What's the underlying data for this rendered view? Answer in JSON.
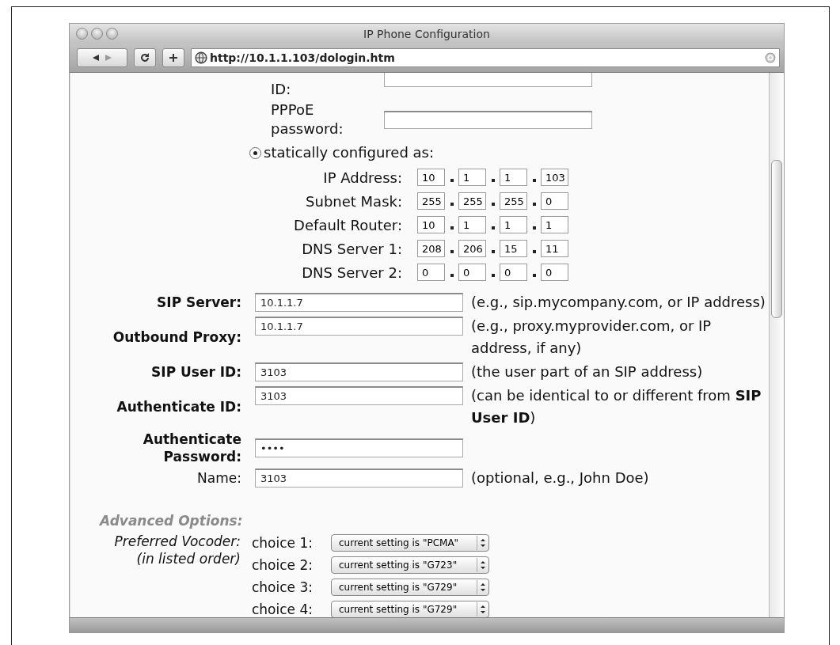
{
  "window": {
    "title": "IP Phone Configuration"
  },
  "toolbar": {
    "url": "http://10.1.1.103/dologin.htm"
  },
  "pppoe_fields": [
    {
      "label": "ID:"
    },
    {
      "label": "PPPoE password:"
    }
  ],
  "static_option": {
    "label": "statically configured as:",
    "selected": true
  },
  "network": [
    {
      "label": "IP Address:",
      "octets": [
        "10",
        "1",
        "1",
        "103"
      ]
    },
    {
      "label": "Subnet Mask:",
      "octets": [
        "255",
        "255",
        "255",
        "0"
      ]
    },
    {
      "label": "Default Router:",
      "octets": [
        "10",
        "1",
        "1",
        "1"
      ]
    },
    {
      "label": "DNS Server 1:",
      "octets": [
        "208",
        "206",
        "15",
        "11"
      ]
    },
    {
      "label": "DNS Server 2:",
      "octets": [
        "0",
        "0",
        "0",
        "0"
      ]
    }
  ],
  "sip_fields": [
    {
      "label": "SIP Server:",
      "bold": true,
      "value": "10.1.1.7",
      "hint": "(e.g., sip.mycompany.com, or IP address)"
    },
    {
      "label": "Outbound Proxy:",
      "bold": true,
      "value": "10.1.1.7",
      "hint": "(e.g., proxy.myprovider.com, or IP address, if any)"
    },
    {
      "label": "SIP User ID:",
      "bold": true,
      "value": "3103",
      "hint": "(the user part of an SIP address)"
    },
    {
      "label": "Authenticate ID:",
      "bold": true,
      "value": "3103",
      "hint": "(can be identical to or different from **SIP User ID**)"
    },
    {
      "label": "Authenticate Password:",
      "bold": true,
      "value": "••••"
    },
    {
      "label": "Name:",
      "bold": false,
      "value": "3103",
      "hint": "(optional, e.g., John Doe)"
    }
  ],
  "advanced": {
    "title": "Advanced Options:",
    "vocoder_label": "Preferred Vocoder:",
    "vocoder_note": "(in listed order)",
    "choices": [
      {
        "label": "choice 1:",
        "value": "current setting is \"PCMA\""
      },
      {
        "label": "choice 2:",
        "value": "current setting is \"G723\""
      },
      {
        "label": "choice 3:",
        "value": "current setting is \"G729\""
      },
      {
        "label": "choice 4:",
        "value": "current setting is \"G729\""
      }
    ]
  }
}
